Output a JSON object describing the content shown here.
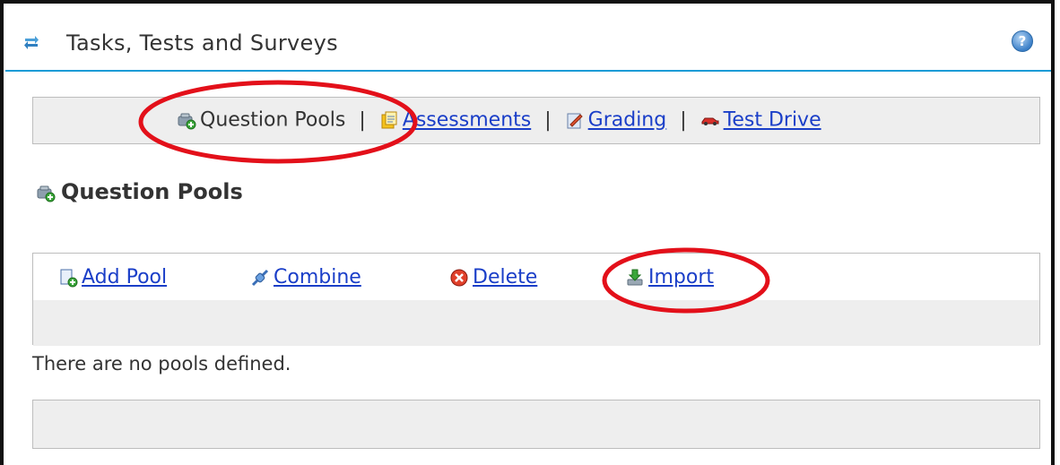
{
  "header": {
    "title": "Tasks, Tests and Surveys",
    "icon": "refresh-arrows-icon",
    "help_icon": "help-icon",
    "help_label": "?"
  },
  "toolbar": {
    "items": [
      {
        "label": "Question Pools",
        "icon": "question-pool-icon",
        "active": true
      },
      {
        "label": "Assessments",
        "icon": "assessment-icon",
        "active": false
      },
      {
        "label": "Grading",
        "icon": "grading-pencil-icon",
        "active": false
      },
      {
        "label": "Test Drive",
        "icon": "car-icon",
        "active": false
      }
    ],
    "separator": "|"
  },
  "section": {
    "title": "Question Pools",
    "icon": "question-pool-icon"
  },
  "actions": [
    {
      "label": "Add Pool",
      "icon": "add-document-icon"
    },
    {
      "label": "Combine",
      "icon": "combine-plug-icon"
    },
    {
      "label": "Delete",
      "icon": "delete-x-icon"
    },
    {
      "label": "Import",
      "icon": "import-arrow-icon"
    }
  ],
  "message": "There are no pools defined.",
  "colors": {
    "accent": "#1a9bd6",
    "link": "#1a3ec8",
    "annotation": "#e3101a",
    "panel": "#eeeeee"
  }
}
